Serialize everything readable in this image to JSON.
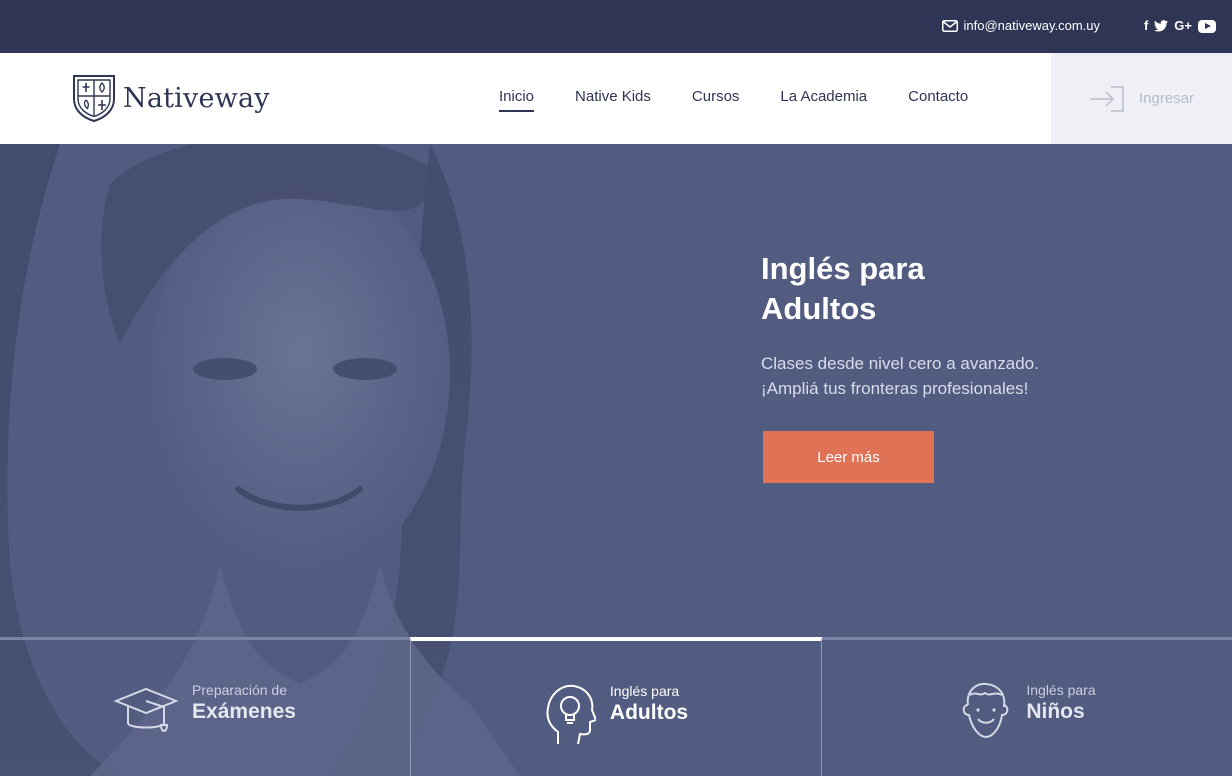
{
  "topbar": {
    "email": "info@nativeway.com.uy",
    "socials": {
      "facebook": "f",
      "twitter": "twitter-icon",
      "google_plus": "G+",
      "youtube": "youtube-icon"
    }
  },
  "header": {
    "brand": "Nativeway",
    "nav": [
      {
        "label": "Inicio",
        "active": true
      },
      {
        "label": "Native Kids"
      },
      {
        "label": "Cursos"
      },
      {
        "label": "La Academia"
      },
      {
        "label": "Contacto"
      }
    ],
    "login_label": "Ingresar"
  },
  "hero": {
    "title_line1": "Inglés para",
    "title_line2": "Adultos",
    "subtitle_line1": "Clases desde nivel cero a avanzado.",
    "subtitle_line2": "¡Ampliá tus fronteras profesionales!",
    "cta_label": "Leer más"
  },
  "tabs": [
    {
      "small": "Preparación de",
      "big": "Exámenes",
      "icon": "graduation-cap-icon"
    },
    {
      "small": "Inglés para",
      "big": "Adultos",
      "icon": "head-lightbulb-icon",
      "active": true
    },
    {
      "small": "Inglés para",
      "big": "Niños",
      "icon": "child-face-icon"
    }
  ],
  "colors": {
    "topbar": "#2f3555",
    "hero_overlay": "#525b80",
    "cta": "#e07256",
    "text_dark": "#2f3555"
  }
}
